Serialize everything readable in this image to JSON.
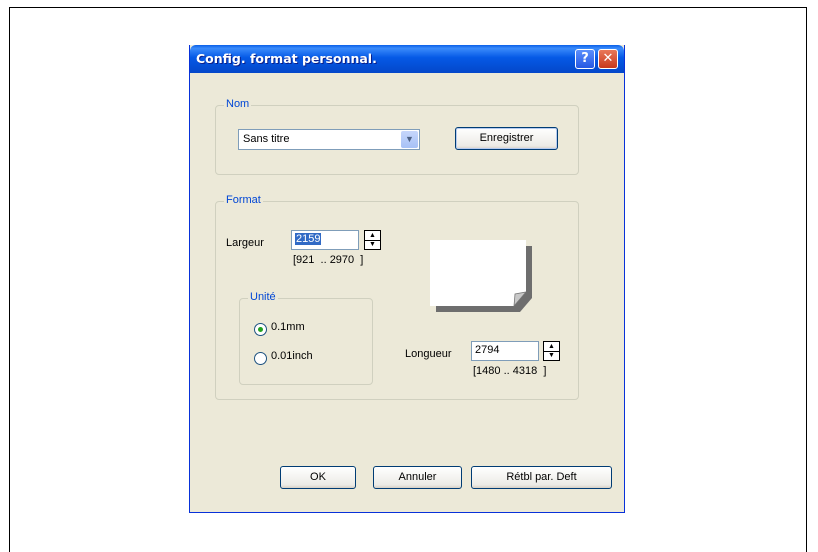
{
  "dialog": {
    "title": "Config. format personnal.",
    "help_label": "?",
    "close_label": "✕"
  },
  "nom": {
    "legend": "Nom",
    "select_value": "Sans titre",
    "save_button": "Enregistrer"
  },
  "format": {
    "legend": "Format",
    "largeur_label": "Largeur",
    "largeur_value": "2159",
    "largeur_range": "[921  .. 2970  ]",
    "longueur_label": "Longueur",
    "longueur_value": "2794",
    "longueur_range": "[1480 .. 4318  ]",
    "unite": {
      "legend": "Unité",
      "options": [
        "0.1mm",
        "0.01inch"
      ],
      "selected": "0.1mm"
    }
  },
  "buttons": {
    "ok": "OK",
    "cancel": "Annuler",
    "reset": "Rétbl par. Deft"
  },
  "colors": {
    "titlebar": "#0559e6",
    "dialog_bg": "#ece9d8",
    "legend_text": "#0046d5",
    "selection": "#316ac5"
  }
}
